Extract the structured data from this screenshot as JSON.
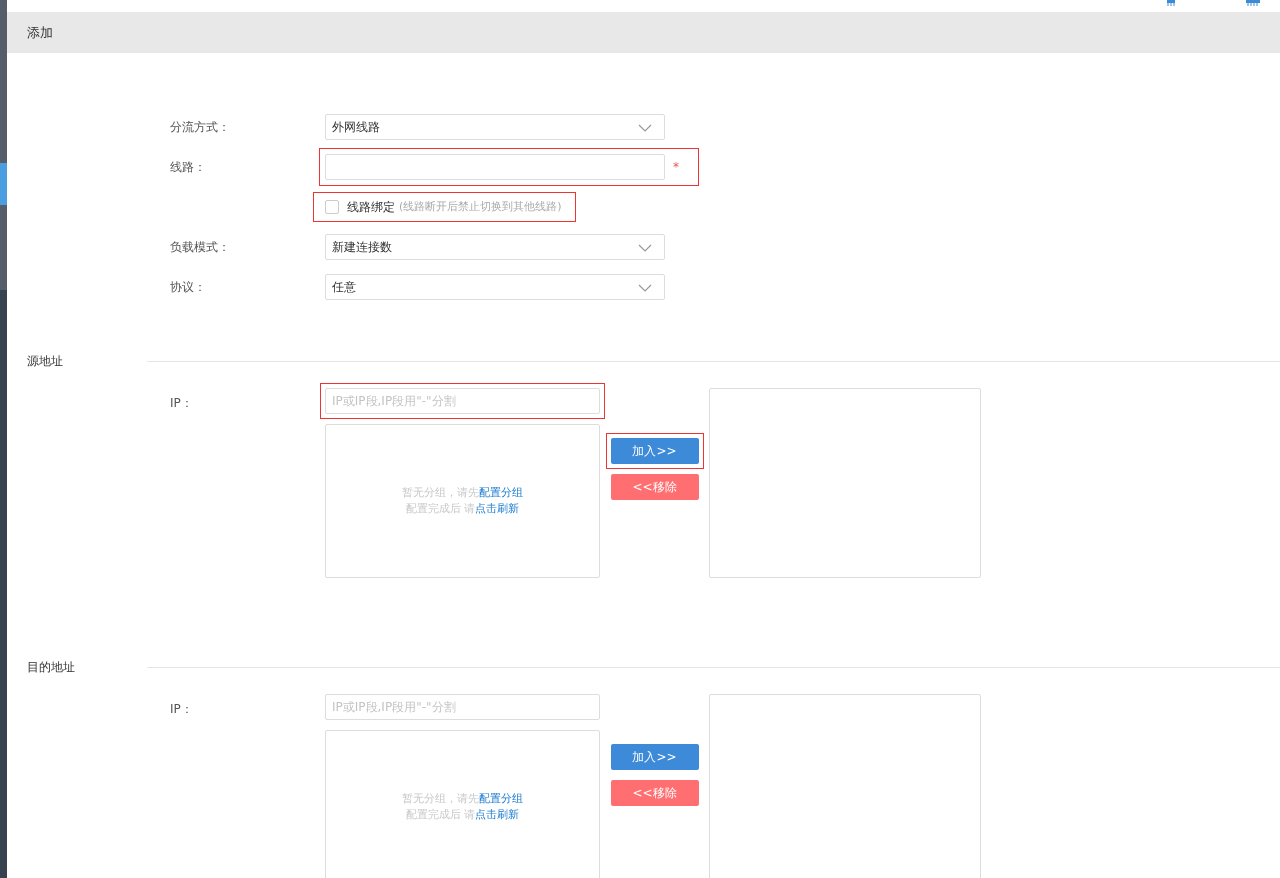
{
  "header": {
    "title": "添加"
  },
  "form": [
    {
      "kind": "select",
      "label": "分流方式：",
      "value": "外网线路",
      "highlighted": false
    },
    {
      "kind": "input",
      "label": "线路：",
      "required_mark": "*",
      "highlighted": true
    },
    {
      "kind": "checkbox",
      "label": "线路绑定",
      "hint": "(线路断开后禁止切换到其他线路)",
      "checked": false,
      "highlighted": true
    },
    {
      "kind": "select",
      "label": "负载模式：",
      "value": "新建连接数",
      "highlighted": false
    },
    {
      "kind": "select",
      "label": "协议：",
      "value": "任意",
      "highlighted": false
    }
  ],
  "sections": [
    {
      "title": "源地址",
      "ip_label": "IP：",
      "placeholder": "IP或IP段,IP段用\"-\"分割",
      "ip_highlighted": true,
      "empty_text": "暂无分组，请先",
      "empty_link": "配置分组",
      "refresh_text": "配置完成后 请",
      "refresh_link": "点击刷新",
      "add_button": "加入>>",
      "add_highlighted": true,
      "remove_button": "<<移除"
    },
    {
      "title": "目的地址",
      "ip_label": "IP：",
      "placeholder": "IP或IP段,IP段用\"-\"分割",
      "ip_highlighted": false,
      "empty_text": "暂无分组，请先",
      "empty_link": "配置分组",
      "refresh_text": "配置完成后 请",
      "refresh_link": "点击刷新",
      "add_button": "加入>>",
      "add_highlighted": false,
      "remove_button": "<<移除"
    }
  ]
}
